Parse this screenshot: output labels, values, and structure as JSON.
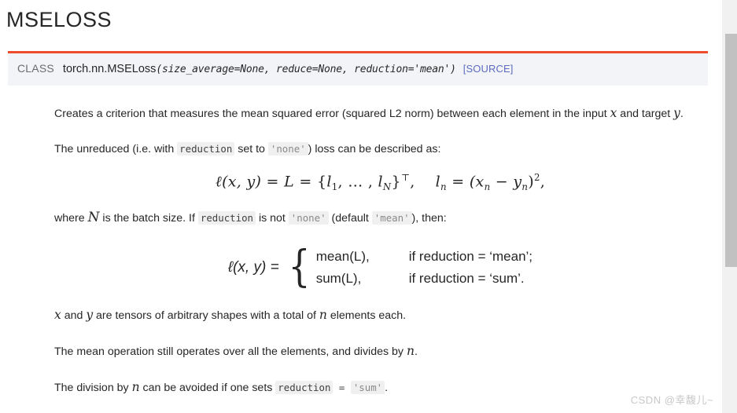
{
  "page": {
    "title": "MSELOSS",
    "brand_accent": "#ee4c2c",
    "link_color": "#5c6bc0",
    "text_color": "#262626"
  },
  "signature": {
    "class_label": "CLASS",
    "qualified_name": "torch.nn.MSELoss",
    "open_paren": "(",
    "params": "size_average=None, reduce=None, reduction='mean'",
    "close_paren": ")",
    "source_link": "[SOURCE]"
  },
  "body": {
    "p1": {
      "t1": "Creates a criterion that measures the mean squared error (squared L2 norm) between each element in the input ",
      "var_x": "x",
      "t2": " and target ",
      "var_y": "y",
      "t3": "."
    },
    "p2": {
      "t1": "The unreduced (i.e. with ",
      "code_reduction": "reduction",
      "t2": " set to ",
      "code_none": "'none'",
      "t3": ") loss can be described as:"
    },
    "p3": {
      "t1": "where ",
      "var_N": "N",
      "t2": " is the batch size. If ",
      "code_reduction": "reduction",
      "t3": " is not ",
      "code_none": "'none'",
      "t4": " (default ",
      "code_mean": "'mean'",
      "t5": "), then:"
    },
    "p4": {
      "var_x": "x",
      "t1": " and ",
      "var_y": "y",
      "t2": " are tensors of arbitrary shapes with a total of ",
      "var_n": "n",
      "t3": " elements each."
    },
    "p5": {
      "t1": "The mean operation still operates over all the elements, and divides by ",
      "var_n": "n",
      "t2": "."
    },
    "p6": {
      "t1": "The division by ",
      "var_n": "n",
      "t2": " can be avoided if one sets ",
      "code_reduction": "reduction",
      "t3": " = ",
      "code_sum": "'sum'",
      "t4": "."
    }
  },
  "equation_one": {
    "lhs_ell": "ℓ",
    "lhs_args": "(x, y)",
    "eq1": " = ",
    "L": "L",
    "eq2": " = ",
    "set_open": "{",
    "l1": "l",
    "l1_sub": "1",
    "dots": ", … , ",
    "lN": "l",
    "lN_sub": "N",
    "set_close": "}",
    "transpose": "⊤",
    "comma": ",",
    "rhs_ln": "l",
    "rhs_ln_sub": "n",
    "rhs_eq": " = ",
    "rhs_body": "(x",
    "rhs_sub1": "n",
    "rhs_minus": " − y",
    "rhs_sub2": "n",
    "rhs_close": ")",
    "rhs_pow": "2",
    "rhs_comma": ","
  },
  "equation_two": {
    "lhs": "ℓ(x, y) =",
    "brace": "{",
    "row1_expr": "mean(L),",
    "row1_cond": "if reduction = ‘mean’;",
    "row2_expr": "sum(L),",
    "row2_cond": "if reduction = ‘sum’."
  },
  "scrollbar": {
    "track_color": "#f1f1f1",
    "thumb_color": "#c1c1c1"
  },
  "watermark": {
    "text": "CSDN @幸馥儿~"
  }
}
